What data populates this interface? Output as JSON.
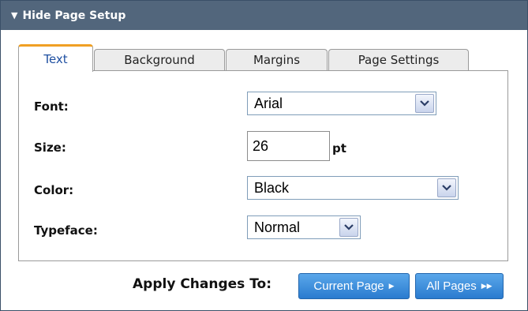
{
  "header": {
    "title": "Hide Page Setup",
    "toggle_icon": "triangle-down-icon"
  },
  "tabs": [
    {
      "label": "Text",
      "active": true
    },
    {
      "label": "Background",
      "active": false
    },
    {
      "label": "Margins",
      "active": false
    },
    {
      "label": "Page Settings",
      "active": false
    }
  ],
  "form": {
    "font": {
      "label": "Font:",
      "value": "Arial"
    },
    "size": {
      "label": "Size:",
      "value": "26",
      "unit": "pt"
    },
    "color": {
      "label": "Color:",
      "value": "Black"
    },
    "typeface": {
      "label": "Typeface:",
      "value": "Normal"
    }
  },
  "footer": {
    "apply_label": "Apply Changes To:",
    "current_page": {
      "label": "Current Page",
      "icon": "arrow-right-icon"
    },
    "all_pages": {
      "label": "All Pages",
      "icon": "double-arrow-right-icon"
    }
  },
  "colors": {
    "header_bg": "#52667c",
    "active_tab_accent": "#f0a024",
    "button_blue": "#2a7bcf"
  }
}
